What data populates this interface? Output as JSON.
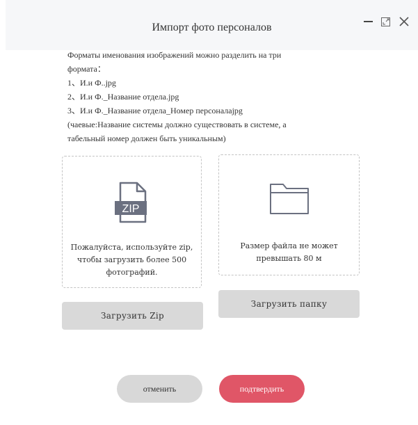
{
  "dialog": {
    "title": "Импорт фото персоналов"
  },
  "window_controls": {
    "minimize_icon": "minimize-icon",
    "maximize_icon": "maximize-icon",
    "close_icon": "close-icon"
  },
  "info": {
    "lines": [
      "Форматы именования изображений можно разделить на три",
      "формата：",
      "1、И.и Ф..jpg",
      "2、И.и Ф._Название отдела.jpg",
      "3、И.и Ф._Название отдела_Номер персоналаjpg",
      "(чаевые:Название системы должно существовать в системе, а",
      "табельный номер должен быть уникальным)"
    ]
  },
  "zip_box": {
    "icon": "zip-file-icon",
    "icon_label": "ZIP",
    "text_lines": [
      "Пожалуйста, используйте zip,",
      "чтобы загрузить более 500",
      "фотографий."
    ],
    "button_label": "Загрузить Zip"
  },
  "folder_box": {
    "icon": "folder-icon",
    "text_lines": [
      "Размер файла не может",
      "превышать 80 м"
    ],
    "button_label": "Загрузить папку"
  },
  "footer": {
    "cancel_label": "отменить",
    "confirm_label": "подтвердить"
  },
  "colors": {
    "header_bg": "#f6f7f9",
    "confirm_bg": "#e05667",
    "gray_button_bg": "#d9d9d9",
    "icon_color": "#6b7080"
  }
}
